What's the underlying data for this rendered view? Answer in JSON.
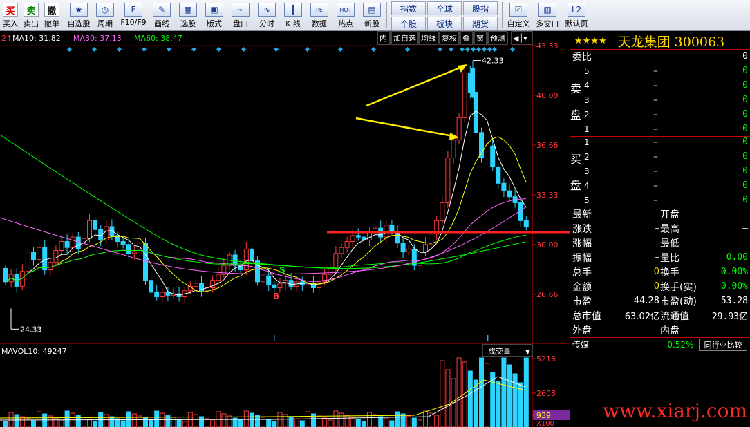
{
  "toolbar": {
    "trade": [
      {
        "glyph": "买",
        "label": "买入"
      },
      {
        "glyph": "卖",
        "label": "卖出"
      },
      {
        "glyph": "撤",
        "label": "撤单"
      }
    ],
    "tools": [
      {
        "icon": "star-icon",
        "glyph": "★",
        "label": "自选股"
      },
      {
        "icon": "clock-icon",
        "glyph": "◷",
        "label": "周期"
      },
      {
        "icon": "f10-icon",
        "glyph": "F",
        "label": "F10/F9"
      },
      {
        "icon": "pen-icon",
        "glyph": "✎",
        "label": "画线"
      },
      {
        "icon": "stock-select-icon",
        "glyph": "▦",
        "label": "选股"
      },
      {
        "icon": "layout-icon",
        "glyph": "▣",
        "label": "版式"
      },
      {
        "icon": "board-icon",
        "glyph": "⌁",
        "label": "盘口"
      },
      {
        "icon": "timeshare-icon",
        "glyph": "∿",
        "label": "分时"
      },
      {
        "icon": "kline-icon",
        "glyph": "┃",
        "label": "K 线"
      },
      {
        "icon": "pe-icon",
        "glyph": "PE",
        "label": "数据"
      },
      {
        "icon": "hot-icon",
        "glyph": "HOT",
        "label": "热点"
      },
      {
        "icon": "new-stock-icon",
        "glyph": "▤",
        "label": "新股"
      }
    ],
    "grid": [
      "指数",
      "全球",
      "股指",
      "个股",
      "板块",
      "期货"
    ],
    "right_tools": [
      {
        "icon": "custom-icon",
        "glyph": "☑",
        "label": "自定义"
      },
      {
        "icon": "multi-window-icon",
        "glyph": "▥",
        "label": "多窗口"
      },
      {
        "icon": "l2-icon",
        "glyph": "L2",
        "label": "默认页"
      }
    ]
  },
  "chart": {
    "ma_legend": [
      {
        "text": "2↑",
        "color": "#ff3b3b"
      },
      {
        "text": "MA10: 31.82",
        "color": "#ffffff"
      },
      {
        "text": "MA30: 37.13",
        "color": "#ff66ff"
      },
      {
        "text": "MA60: 38.47",
        "color": "#00ff00"
      }
    ],
    "mini_buttons": [
      "内",
      "加自选",
      "均线",
      "复权",
      "叠",
      "窗",
      "预测"
    ],
    "y_ticks": [
      "43.33",
      "40.00",
      "36.66",
      "33.33",
      "30.00",
      "26.66"
    ],
    "high_label": "42.33",
    "low_label": "24.33",
    "markers": {
      "s": "S",
      "b": "B",
      "l1": "L",
      "l2": "L"
    },
    "vol_legend": "MAVOL10: 49247",
    "vol_button": "成交量",
    "vol_ticks": [
      "5216",
      "2608",
      "939"
    ],
    "vol_unit": "X100"
  },
  "panel": {
    "stars": "★★★★",
    "name": "天龙集团 300063",
    "weibi": {
      "label": "委比",
      "value": "0"
    },
    "sell_label": [
      "卖",
      "盘"
    ],
    "buy_label": [
      "买",
      "盘"
    ],
    "sell_levels": [
      "5",
      "4",
      "3",
      "2",
      "1"
    ],
    "buy_levels": [
      "1",
      "2",
      "3",
      "4",
      "5"
    ],
    "level_dash": "–",
    "level_val": "0",
    "stats": [
      {
        "l": "最新",
        "v1": "–",
        "l2": "开盘",
        "v2": "–"
      },
      {
        "l": "涨跌",
        "v1": "–",
        "l2": "最高",
        "v2": "–"
      },
      {
        "l": "涨幅",
        "v1": "–",
        "l2": "最低",
        "v2": "–"
      },
      {
        "l": "振幅",
        "v1": "–",
        "l2": "量比",
        "v2": "0.00"
      },
      {
        "l": "总手",
        "v1": "0",
        "l2": "换手",
        "v2": "0.00%"
      },
      {
        "l": "金额",
        "v1": "0",
        "l2": "换手(实)",
        "v2": "0.00%"
      },
      {
        "l": "市盈",
        "v1": "44.28",
        "l2": "市盈(动)",
        "v2": "53.28"
      },
      {
        "l": "总市值",
        "v1": "63.02亿",
        "l2": "流通值",
        "v2": "29.93亿"
      },
      {
        "l": "外盘",
        "v1": "–",
        "l2": "内盘",
        "v2": "–"
      }
    ],
    "industry": {
      "label": "传媒",
      "change": "-0.52%",
      "button": "同行业比较"
    },
    "watermark": "www.xiarj.com"
  }
}
